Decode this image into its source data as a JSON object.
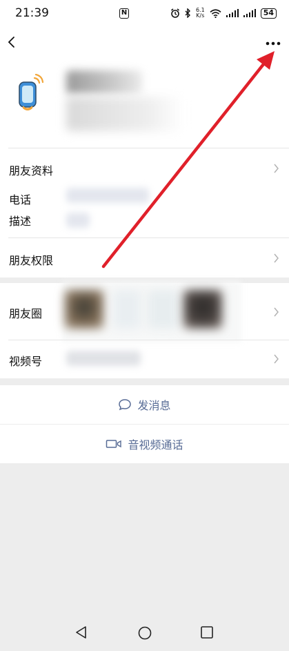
{
  "status_bar": {
    "time": "21:39",
    "net_speed_value": "6.1",
    "net_speed_unit": "K/s",
    "battery": "54",
    "icons": [
      "nfc-icon",
      "alarm-icon",
      "bluetooth-icon",
      "wifi-icon",
      "signal-icon",
      "signal-icon",
      "battery-icon"
    ]
  },
  "header": {
    "back_icon": "chevron-left-icon",
    "more_icon": "more-dots-icon"
  },
  "profile": {
    "avatar_icon": "device-watch-icon"
  },
  "rows": {
    "friend_info_label": "朋友资料",
    "phone_label": "电话",
    "description_label": "描述",
    "friend_permissions_label": "朋友权限",
    "moments_label": "朋友圈",
    "channels_label": "视频号"
  },
  "actions": {
    "send_message_label": "发消息",
    "voice_video_call_label": "音视频通话"
  },
  "colors": {
    "link_blue": "#576b95",
    "annotation_red": "#e0202a",
    "background": "#ededed"
  },
  "system_nav": {
    "back_icon": "triangle-back-icon",
    "home_icon": "circle-home-icon",
    "recents_icon": "square-recents-icon"
  }
}
